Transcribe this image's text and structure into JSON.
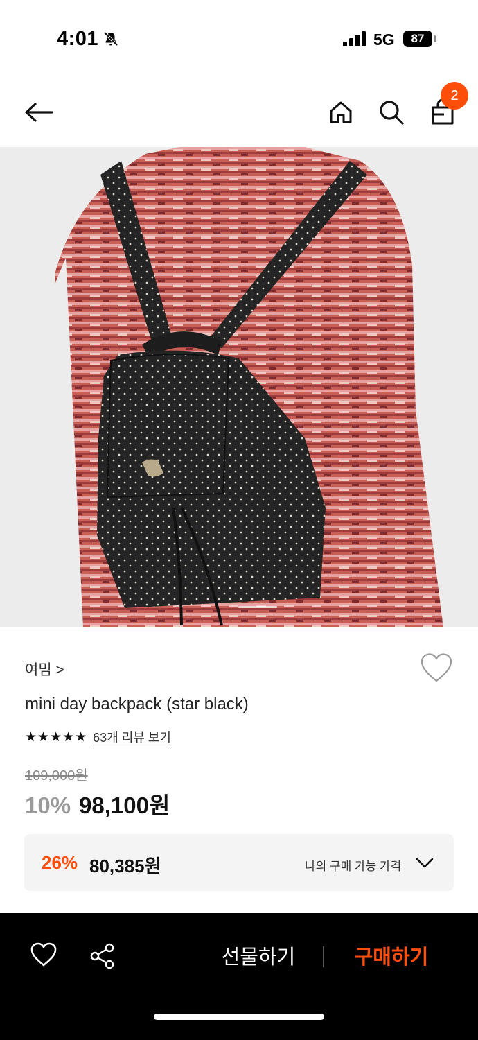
{
  "status": {
    "time": "4:01",
    "network": "5G",
    "battery": "87"
  },
  "header": {
    "cart_count": "2"
  },
  "product": {
    "brand": "여밈 >",
    "name": "mini day backpack (star black)",
    "stars": "★★★★★",
    "review_link": "63개 리뷰 보기",
    "original_price": "109,000원",
    "discount_rate": "10%",
    "sale_price": "98,100원"
  },
  "my_price": {
    "rate": "26%",
    "price": "80,385원",
    "label": "나의 구매 가능 가격"
  },
  "bottom_bar": {
    "gift_label": "선물하기",
    "buy_label": "구매하기"
  },
  "colors": {
    "accent": "#ff4d0a",
    "bar_background": "#000000"
  },
  "icons": [
    "bell-slash-icon",
    "signal-icon",
    "arrow-left-icon",
    "home-icon",
    "search-icon",
    "shopping-bag-icon",
    "heart-icon",
    "share-icon",
    "chevron-down-icon"
  ]
}
